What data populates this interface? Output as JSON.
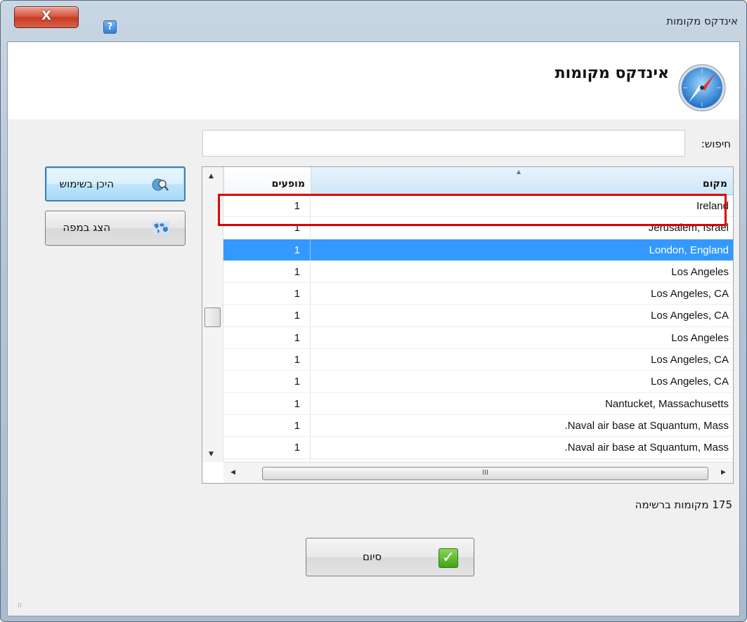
{
  "window": {
    "title": "אינדקס מקומות",
    "close_label": "X",
    "help_label": "?"
  },
  "header": {
    "title": "אינדקס מקומות",
    "icon": "compass-icon"
  },
  "search": {
    "label": "חיפוש:",
    "value": "",
    "placeholder": ""
  },
  "grid": {
    "columns": [
      "מופעים",
      "מקום"
    ],
    "sorted_column": "מקום",
    "selected_index": 2,
    "rows": [
      {
        "count": "1",
        "place": "Ireland"
      },
      {
        "count": "1",
        "place": "Jerusalem, Israel"
      },
      {
        "count": "1",
        "place": "London, England"
      },
      {
        "count": "1",
        "place": "Los Angeles"
      },
      {
        "count": "1",
        "place": "Los Angeles, CA"
      },
      {
        "count": "1",
        "place": "Los Angeles, CA"
      },
      {
        "count": "1",
        "place": "Los Angeles"
      },
      {
        "count": "1",
        "place": "Los Angeles, CA"
      },
      {
        "count": "1",
        "place": "Los Angeles, CA"
      },
      {
        "count": "1",
        "place": "Nantucket, Massachusetts"
      },
      {
        "count": "1",
        "place": ".Naval air base at Squantum, Mass"
      },
      {
        "count": "1",
        "place": ".Naval air base at Squantum, Mass"
      },
      {
        "count": "1",
        "place": ""
      }
    ],
    "hscroll_thumb_label": "III"
  },
  "side_buttons": {
    "where_used": {
      "label": "היכן בשימוש",
      "icon": "search-globe-icon"
    },
    "show_map": {
      "label": "הצג במפה",
      "icon": "world-map-icon"
    }
  },
  "status": {
    "text": "175 מקומות ברשימה"
  },
  "footer": {
    "finish_label": "סיום",
    "finish_icon": "checkmark-icon"
  },
  "colors": {
    "selection": "#3399ff",
    "highlight_box": "#e00000",
    "close_button": "#c63a22"
  }
}
